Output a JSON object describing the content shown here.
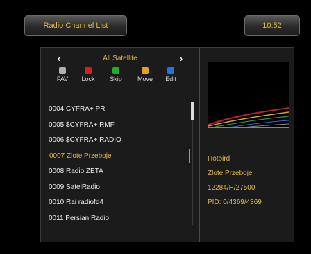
{
  "header": {
    "title": "Radio Channel List",
    "time": "10:52"
  },
  "satellite": {
    "left_arrow": "‹",
    "label": "All Satellite",
    "right_arrow": "›"
  },
  "color_keys": [
    {
      "label": "FAV",
      "color": "#b0b0b0"
    },
    {
      "label": "Lock",
      "color": "#d42020"
    },
    {
      "label": "Skip",
      "color": "#20b02a"
    },
    {
      "label": "Move",
      "color": "#e0a020"
    },
    {
      "label": "Edit",
      "color": "#2870e0"
    }
  ],
  "channels": [
    {
      "text": "0004 CYFRA+ PR"
    },
    {
      "text": "0005 $CYFRA+ RMF"
    },
    {
      "text": "0006 $CYFRA+ RADIO"
    },
    {
      "text": "0007 Zlote Przeboje"
    },
    {
      "text": "0008 Radio ZETA"
    },
    {
      "text": "0009 SatelRadio"
    },
    {
      "text": "0010 Rai radiofd4"
    },
    {
      "text": "0011 Persian Radio"
    }
  ],
  "selected_index": 3,
  "info": {
    "satellite": "Hotbird",
    "channel": "Zlote Przeboje",
    "transponder": "12284/H/27500",
    "pid": "PID: 0/4369/4369"
  },
  "colors": {
    "accent": "#e0b84a",
    "selection_border": "#b89a3a",
    "panel": "#1b1b1b"
  }
}
